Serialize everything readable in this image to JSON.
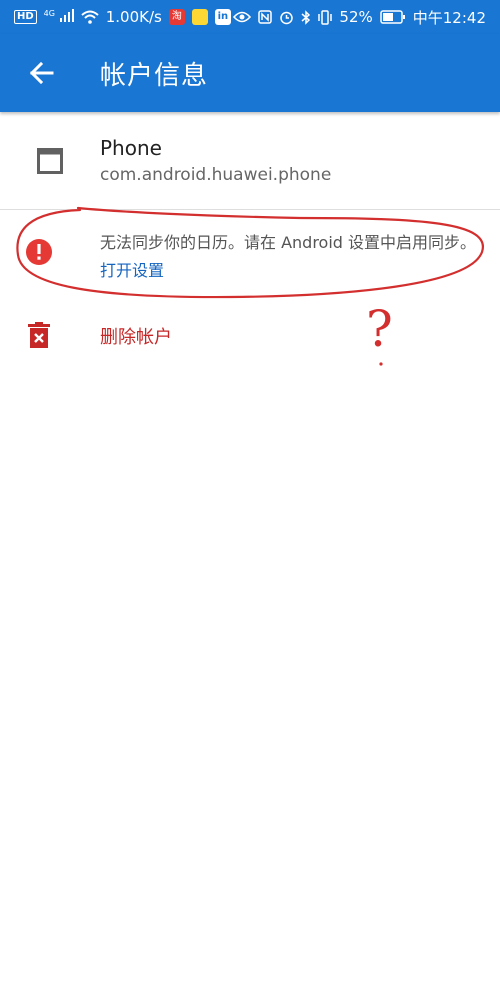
{
  "statusbar": {
    "hd": "HD",
    "network": "4G",
    "speed": "1.00K/s",
    "app_icons": [
      "淘",
      "",
      "in"
    ],
    "battery": "52%",
    "time": "中午12:42"
  },
  "appbar": {
    "title": "帐户信息",
    "back_icon": "arrow-left-icon"
  },
  "account": {
    "name": "Phone",
    "package": "com.android.huawei.phone",
    "icon": "window-icon"
  },
  "error": {
    "message": "无法同步你的日历。请在 Android 设置中启用同步。",
    "link": "打开设置",
    "icon": "error-icon"
  },
  "delete": {
    "label": "删除帐户",
    "icon": "trash-icon"
  },
  "annotation": {
    "mark": "?"
  },
  "colors": {
    "primary": "#1976d2",
    "danger": "#c62828",
    "error_icon": "#e53935",
    "link": "#1565c0",
    "annotation": "#d32f2f"
  }
}
